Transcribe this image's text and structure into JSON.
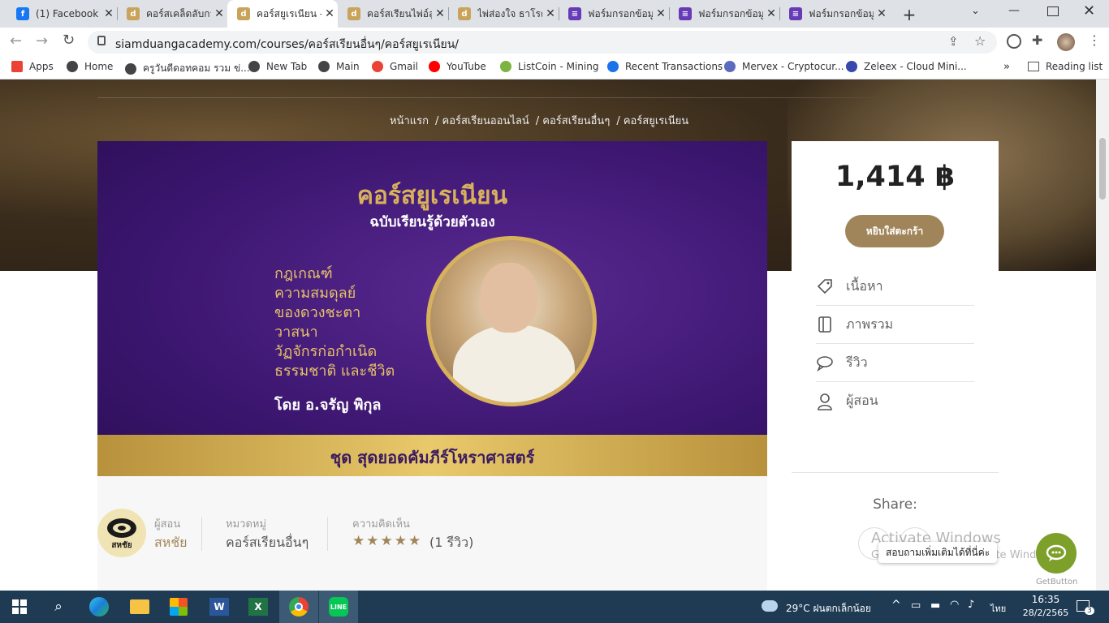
{
  "browser": {
    "tabs": [
      {
        "title": "(1) Facebook",
        "icon": "facebook-icon",
        "color": "#1877f2",
        "glyph": "f"
      },
      {
        "title": "คอร์สเคล็ดลับกา",
        "icon": "academy-favicon",
        "color": "#c9a35a",
        "glyph": "d"
      },
      {
        "title": "คอร์สยูเรเนียน -",
        "icon": "academy-favicon",
        "color": "#c9a35a",
        "glyph": "d",
        "active": true
      },
      {
        "title": "คอร์สเรียนไพ่อ์ลู",
        "icon": "academy-favicon",
        "color": "#c9a35a",
        "glyph": "d"
      },
      {
        "title": "ไพ่ส่องใจ ธาโรต์",
        "icon": "academy-favicon",
        "color": "#c9a35a",
        "glyph": "d"
      },
      {
        "title": "ฟอร์มกรอกข้อมู",
        "icon": "forms-icon",
        "color": "#673ab7",
        "glyph": "≡"
      },
      {
        "title": "ฟอร์มกรอกข้อมู",
        "icon": "forms-icon",
        "color": "#673ab7",
        "glyph": "≡"
      },
      {
        "title": "ฟอร์มกรอกข้อมู",
        "icon": "forms-icon",
        "color": "#673ab7",
        "glyph": "≡"
      }
    ],
    "url": "siamduangacademy.com/courses/คอร์สเรียนอื่นๆ/คอร์สยูเรเนียน/",
    "bookmarks": [
      {
        "label": "Apps",
        "color": "#ea4335"
      },
      {
        "label": "Home",
        "color": "#444"
      },
      {
        "label": "ครูวันดีดอทคอม รวม ข่...",
        "color": "#444"
      },
      {
        "label": "New Tab",
        "color": "#444"
      },
      {
        "label": "Main",
        "color": "#444"
      },
      {
        "label": "Gmail",
        "color": "#ea4335"
      },
      {
        "label": "YouTube",
        "color": "#ff0000"
      },
      {
        "label": "ListCoin - Mining",
        "color": "#7cb342"
      },
      {
        "label": "Recent Transactions",
        "color": "#1a73e8"
      },
      {
        "label": "Mervex - Cryptocur...",
        "color": "#5c6bc0"
      },
      {
        "label": "Zeleex - Cloud Mini...",
        "color": "#3949ab"
      }
    ],
    "more_bookmarks": "»",
    "reading_list": "Reading list"
  },
  "breadcrumb": [
    "หน้าแรก",
    "/ คอร์สเรียนออนไลน์",
    "/ คอร์สเรียนอื่นๆ",
    "/ คอร์สยูเรเนียน"
  ],
  "banner": {
    "title": "คอร์สยูเรเนียน",
    "subtitle": "ฉบับเรียนรู้ด้วยตัวเอง",
    "topics": [
      "กฎเกณฑ์",
      "ความสมดุลย์",
      "ของดวงชะตา",
      "วาสนา",
      "วัฏจักรก่อกำเนิด",
      "ธรรมชาติ และชีวิต"
    ],
    "by": "โดย อ.จรัญ พิกุล",
    "series": "ชุด สุดยอดคัมภีร์โหราศาสตร์"
  },
  "meta": {
    "instructor_label": "ผู้สอน",
    "instructor": "สหชัย",
    "logo_text": "สหชัย",
    "category_label": "หมวดหมู่",
    "category": "คอร์สเรียนอื่นๆ",
    "review_label": "ความคิดเห็น",
    "rating": 5,
    "review_count": "(1 รีวิว)"
  },
  "sidebar": {
    "price": "1,414 ฿",
    "cart_button": "หยิบใส่ตะกร้า",
    "items": [
      {
        "label": "เนื้อหา",
        "icon": "tag-icon"
      },
      {
        "label": "ภาพรวม",
        "icon": "book-icon"
      },
      {
        "label": "รีวิว",
        "icon": "chat-icon"
      },
      {
        "label": "ผู้สอน",
        "icon": "user-icon"
      }
    ],
    "share": "Share:"
  },
  "chat": {
    "label": "สอบถามเพิ่มเติมได้ที่นี่ค่ะ",
    "brand": "GetButton"
  },
  "watermark": {
    "title": "Activate Windows",
    "subtitle": "Go to Settings to activate Windows."
  },
  "taskbar": {
    "weather": "29°C  ฝนตกเล็กน้อย",
    "language": "ไทย",
    "time": "16:35",
    "date": "28/2/2565",
    "notifications": "3"
  }
}
